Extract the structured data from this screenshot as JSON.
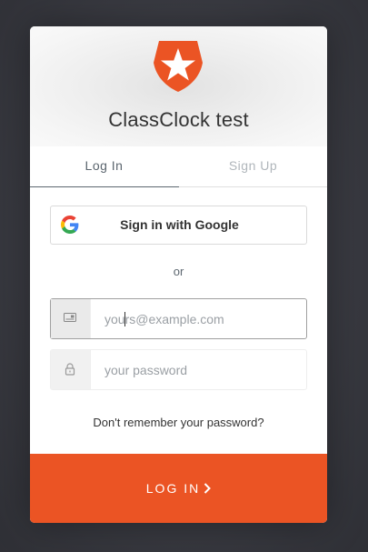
{
  "app": {
    "title": "ClassClock test"
  },
  "tabs": [
    {
      "label": "Log In",
      "active": true
    },
    {
      "label": "Sign Up",
      "active": false
    }
  ],
  "social": {
    "google_label": "Sign in with Google"
  },
  "separator": "or",
  "form": {
    "email": {
      "placeholder": "yours@example.com",
      "value": ""
    },
    "password": {
      "placeholder": "your password",
      "value": ""
    }
  },
  "forgot_label": "Don't remember your password?",
  "submit_label": "LOG IN",
  "icons": {
    "logo": "auth0-shield-star-icon",
    "google": "google-g-icon",
    "email": "id-card-icon",
    "password": "lock-icon",
    "submit": "chevron-right-icon"
  },
  "colors": {
    "accent": "#eb5424",
    "tab_active": "#5c666f",
    "tab_inactive": "#b0b6bb"
  }
}
